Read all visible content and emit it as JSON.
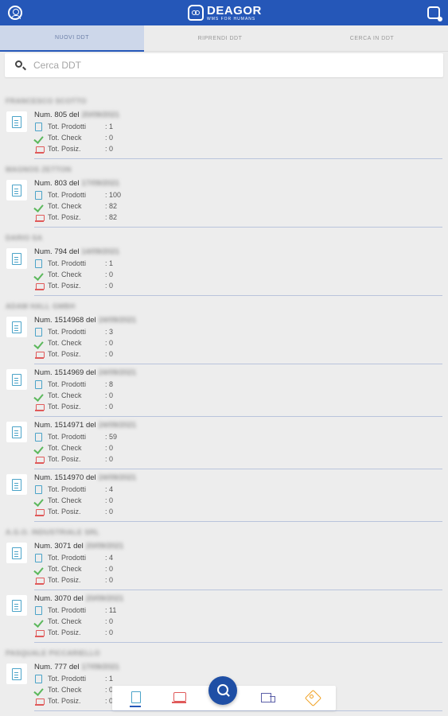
{
  "appbar": {
    "brand": "DEAGOR",
    "tagline": "WMS FOR HUMANS",
    "icons": {
      "left": "user-circle-icon",
      "right": "sync-device-icon"
    }
  },
  "tabs": [
    {
      "label": "NUOVI DDT",
      "active": true
    },
    {
      "label": "RIPRENDI DDT",
      "active": false
    },
    {
      "label": "CERCA IN DDT",
      "active": false
    }
  ],
  "search": {
    "placeholder": "Cerca DDT",
    "value": ""
  },
  "labels": {
    "prodotti": "Tot. Prodotti",
    "check": "Tot. Check",
    "posiz": "Tot. Posiz."
  },
  "groups": [
    {
      "supplier": "FRANCESCO SCOTTO",
      "items": [
        {
          "num": "Num. 805 del",
          "date": "20/09/2021",
          "prodotti": ": 1",
          "check": ": 0",
          "posiz": ": 0"
        }
      ]
    },
    {
      "supplier": "MAGNOS ZETTON",
      "items": [
        {
          "num": "Num. 803 del",
          "date": "17/09/2021",
          "prodotti": ": 100",
          "check": ": 82",
          "posiz": ": 82"
        }
      ]
    },
    {
      "supplier": "DARIO SA",
      "items": [
        {
          "num": "Num. 794 del",
          "date": "14/09/2021",
          "prodotti": ": 1",
          "check": ": 0",
          "posiz": ": 0"
        }
      ]
    },
    {
      "supplier": "ADAM HALL GMBH",
      "items": [
        {
          "num": "Num. 1514968 del",
          "date": "24/09/2021",
          "prodotti": ": 3",
          "check": ": 0",
          "posiz": ": 0"
        },
        {
          "num": "Num. 1514969 del",
          "date": "24/09/2021",
          "prodotti": ": 8",
          "check": ": 0",
          "posiz": ": 0"
        },
        {
          "num": "Num. 1514971 del",
          "date": "24/09/2021",
          "prodotti": ": 59",
          "check": ": 0",
          "posiz": ": 0"
        },
        {
          "num": "Num. 1514970 del",
          "date": "24/09/2021",
          "prodotti": ": 4",
          "check": ": 0",
          "posiz": ": 0"
        }
      ]
    },
    {
      "supplier": "A.G.O. INDUSTRIALE SRL",
      "items": [
        {
          "num": "Num. 3071 del",
          "date": "20/09/2021",
          "prodotti": ": 4",
          "check": ": 0",
          "posiz": ": 0"
        },
        {
          "num": "Num. 3070 del",
          "date": "20/09/2021",
          "prodotti": ": 11",
          "check": ": 0",
          "posiz": ": 0"
        }
      ]
    },
    {
      "supplier": "PASQUALE PICCARIELLO",
      "items": [
        {
          "num": "Num. 777 del",
          "date": "17/09/2021",
          "prodotti": ": 1",
          "check": ": 0",
          "posiz": ": 0"
        }
      ]
    }
  ],
  "bottom_nav": {
    "items": [
      "document-icon",
      "pallet-position-icon",
      "search-icon",
      "truck-icon",
      "tag-icon"
    ]
  }
}
